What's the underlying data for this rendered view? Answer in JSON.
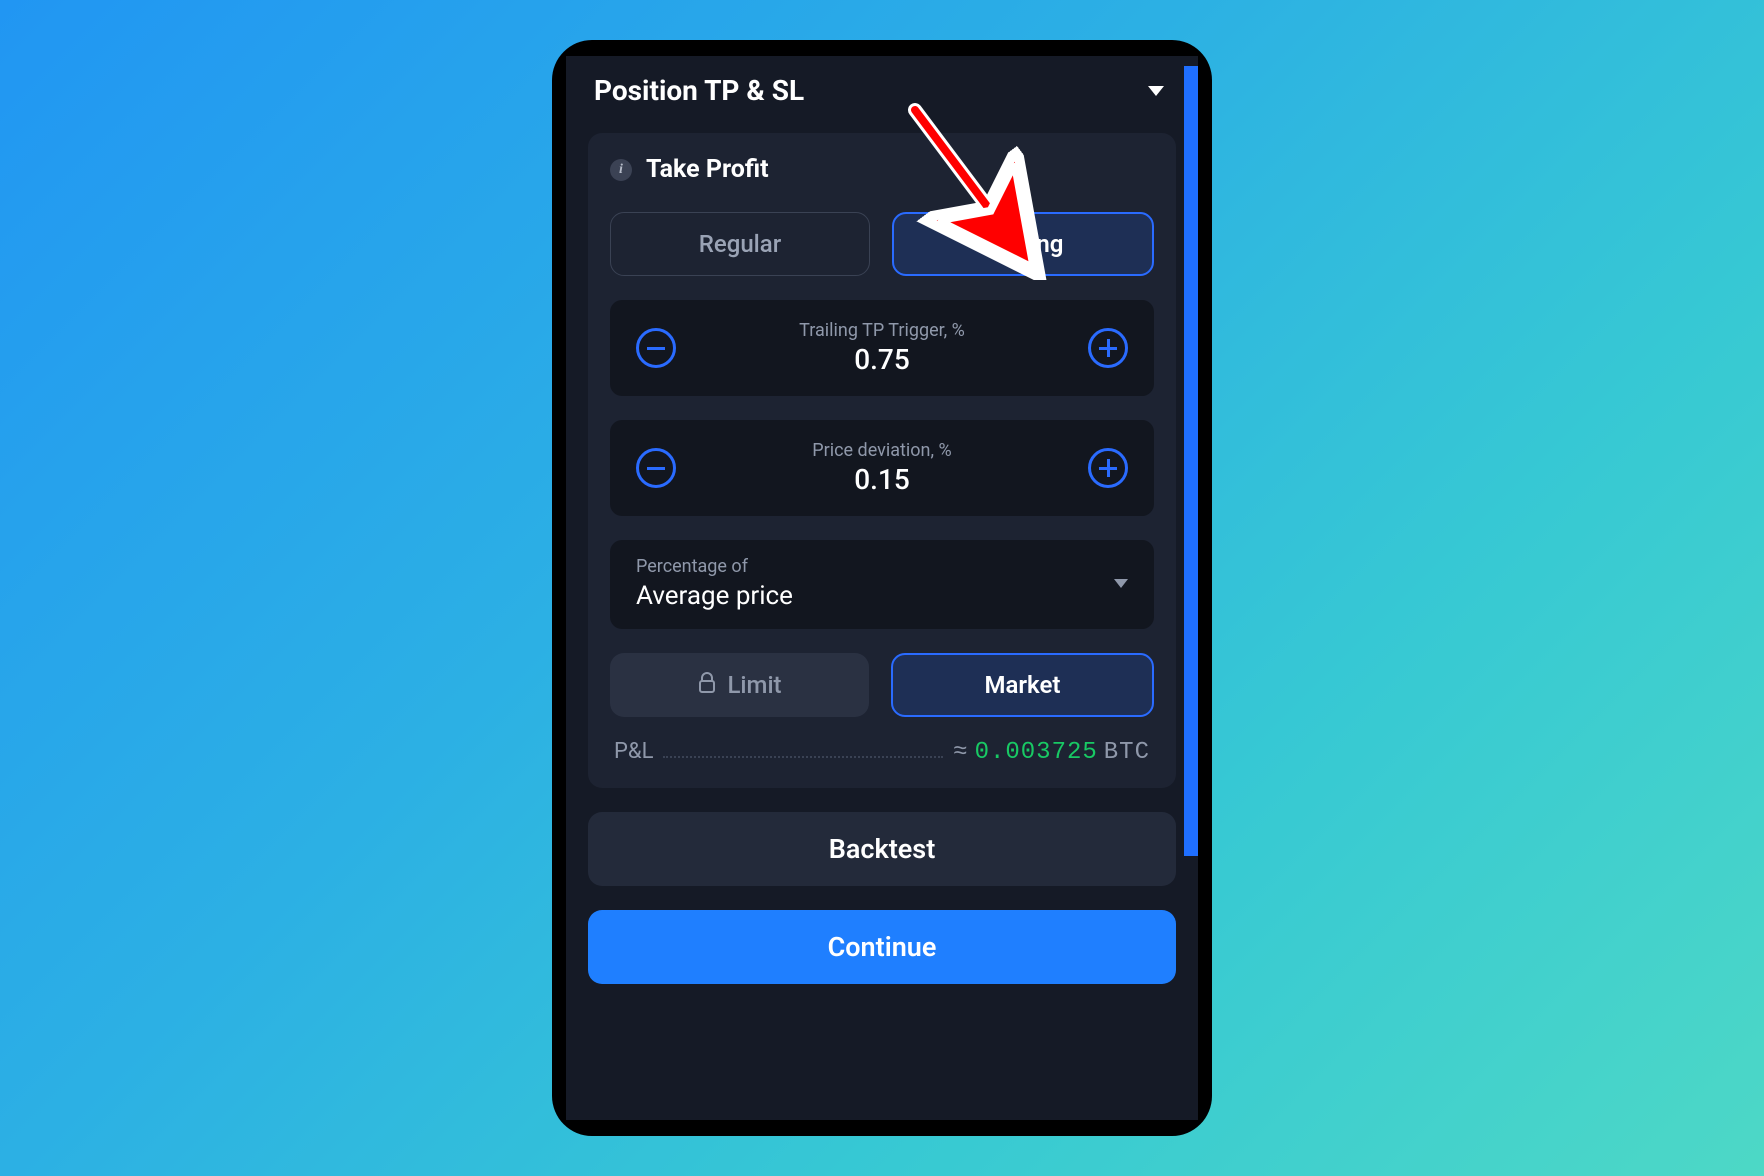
{
  "header": {
    "title": "Position TP & SL"
  },
  "takeProfit": {
    "sectionLabel": "Take Profit",
    "tabs": {
      "regular": "Regular",
      "trailing": "Trailing"
    },
    "trailingTrigger": {
      "label": "Trailing TP Trigger, %",
      "value": "0.75"
    },
    "priceDeviation": {
      "label": "Price deviation, %",
      "value": "0.15"
    },
    "percentageOf": {
      "label": "Percentage of",
      "value": "Average price"
    },
    "orderType": {
      "limit": "Limit",
      "market": "Market"
    },
    "pnl": {
      "label": "P&L",
      "approx": "≈",
      "value": "0.003725",
      "unit": "BTC"
    }
  },
  "actions": {
    "backtest": "Backtest",
    "continue": "Continue"
  },
  "colors": {
    "accent": "#1f7fff",
    "positive": "#18c964"
  }
}
